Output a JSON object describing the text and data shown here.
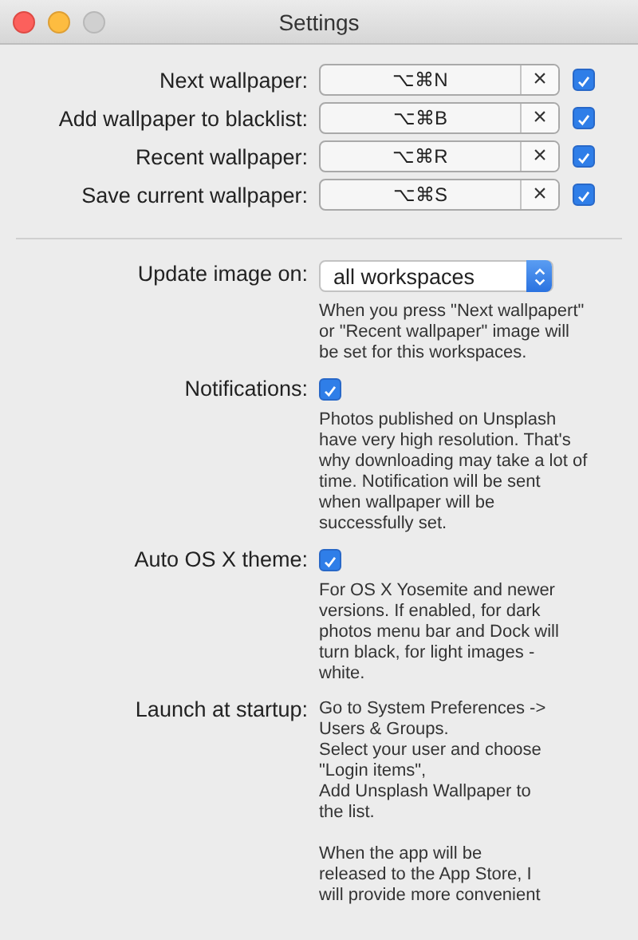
{
  "window": {
    "title": "Settings"
  },
  "shortcuts": [
    {
      "label": "Next wallpaper:",
      "keys": "⌥⌘N",
      "clear": "×",
      "enabled": true
    },
    {
      "label": "Add wallpaper to blacklist:",
      "keys": "⌥⌘B",
      "clear": "×",
      "enabled": true
    },
    {
      "label": "Recent wallpaper:",
      "keys": "⌥⌘R",
      "clear": "×",
      "enabled": true
    },
    {
      "label": "Save current wallpaper:",
      "keys": "⌥⌘S",
      "clear": "×",
      "enabled": true
    }
  ],
  "options": [
    {
      "kind": "select",
      "label": "Update image on:",
      "value": "all workspaces",
      "description": [
        [
          "When you press \"Next wallpapert\"",
          "or \"Recent wallpaper\" image will",
          "be set for this workspaces."
        ]
      ]
    },
    {
      "kind": "checkbox",
      "label": "Notifications:",
      "checked": true,
      "description": [
        [
          "Photos published on Unsplash",
          "have very high resolution. That's",
          "why downloading may take a lot of",
          "time. Notification will be sent",
          "when wallpaper will be",
          "successfully set."
        ]
      ]
    },
    {
      "kind": "checkbox",
      "label": "Auto OS X theme:",
      "checked": true,
      "description": [
        [
          "For OS X Yosemite and newer",
          "versions. If enabled, for dark",
          "photos menu bar and Dock will",
          "turn black, for light images -",
          "white."
        ]
      ]
    },
    {
      "kind": "text",
      "label": "Launch at startup:",
      "description": [
        [
          "Go to System Preferences ->",
          "Users & Groups.",
          "Select your user and choose",
          "\"Login items\",",
          "Add Unsplash Wallpaper to",
          "the list."
        ],
        [
          "When the app will be",
          "released to the App Store, I",
          "will provide more convenient"
        ]
      ]
    }
  ]
}
